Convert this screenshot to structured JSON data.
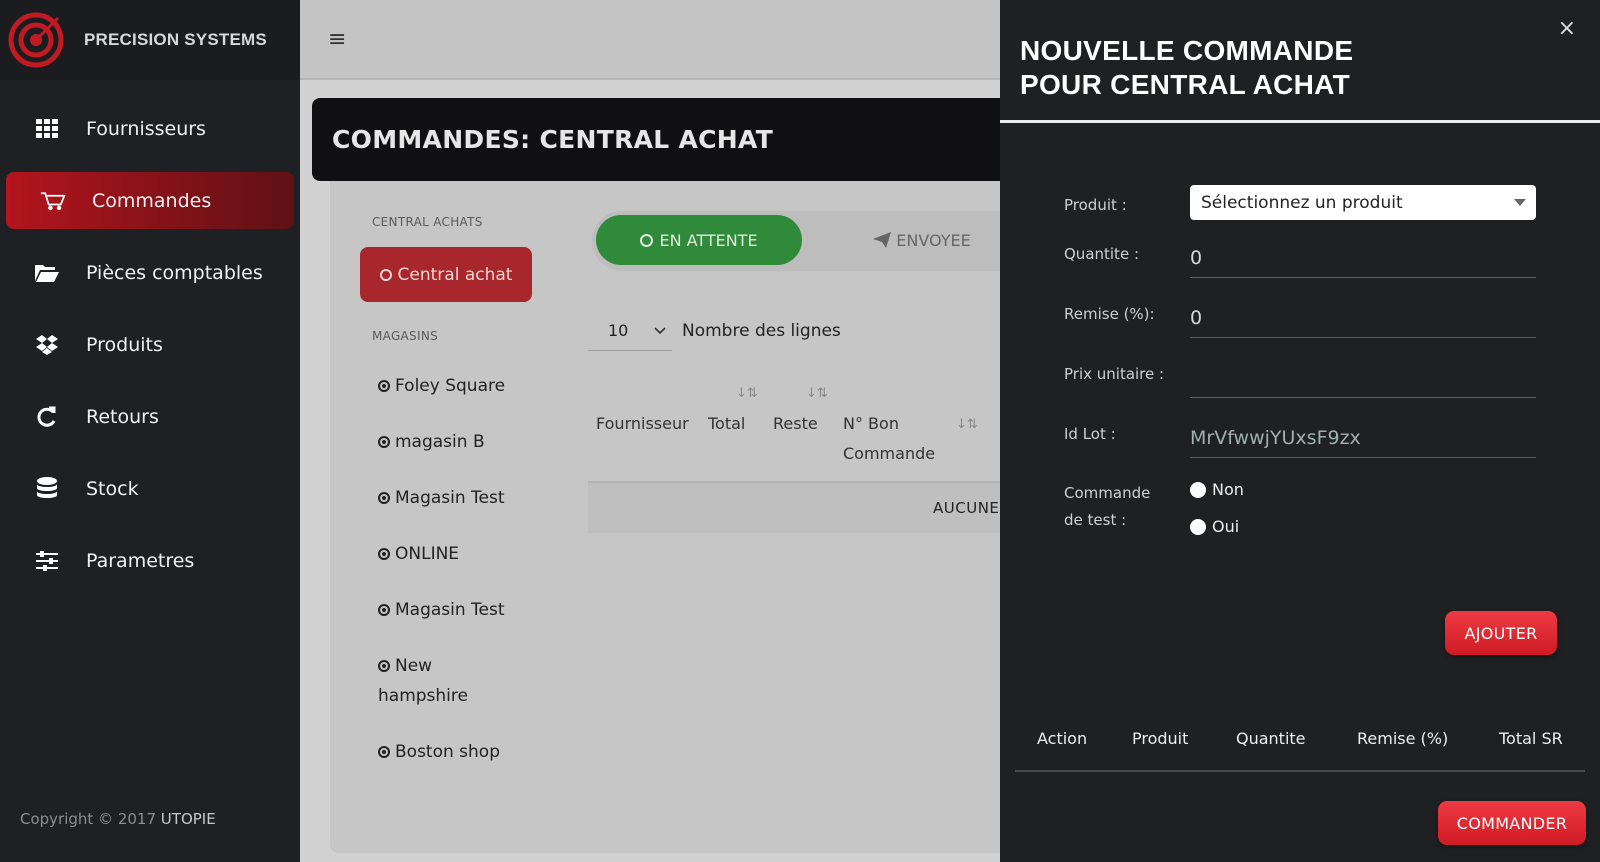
{
  "brand": {
    "name": "PRECISION SYSTEMS"
  },
  "sidebar": {
    "items": [
      {
        "label": "Fournisseurs",
        "icon": "grid-icon"
      },
      {
        "label": "Commandes",
        "icon": "cart-icon",
        "active": true
      },
      {
        "label": "Pièces comptables",
        "icon": "folder-icon"
      },
      {
        "label": "Produits",
        "icon": "dropbox-icon"
      },
      {
        "label": "Retours",
        "icon": "refresh-icon"
      },
      {
        "label": "Stock",
        "icon": "database-icon"
      },
      {
        "label": "Parametres",
        "icon": "sliders-icon"
      }
    ],
    "copyright_prefix": "Copyright © 2017",
    "copyright_brand": "UTOPIE"
  },
  "page": {
    "title": "COMMANDES: CENTRAL ACHAT",
    "central_label": "CENTRAL ACHATS",
    "central_button": "Central achat",
    "stores_label": "MAGASINS",
    "stores": [
      "Foley Square",
      "magasin B",
      "Magasin Test",
      "ONLINE",
      "Magasin Test",
      "New hampshire",
      "Boston shop"
    ],
    "tabs": {
      "pending": "EN ATTENTE",
      "sent": "ENVOYEE"
    },
    "rows_per_page": "10",
    "rows_label": "Nombre des lignes",
    "table": {
      "col_supplier": "Fournisseur",
      "col_total": "Total",
      "col_rest": "Reste",
      "col_order_no_1": "N° Bon",
      "col_order_no_2": "Commande"
    },
    "empty_text": "AUCUNE"
  },
  "drawer": {
    "title_line1": "NOUVELLE COMMANDE",
    "title_line2": "POUR CENTRAL ACHAT",
    "close": "×",
    "product_label": "Produit :",
    "product_placeholder": "Sélectionnez un produit",
    "quantity_label": "Quantite :",
    "quantity_value": "0",
    "discount_label": "Remise (%):",
    "discount_value": "0",
    "unit_price_label": "Prix unitaire :",
    "unit_price_value": "",
    "lot_label": "Id Lot :",
    "lot_value": "MrVfwwjYUxsF9zx",
    "test_label_1": "Commande",
    "test_label_2": "de test :",
    "opt_no": "Non",
    "opt_yes": "Oui",
    "add_button": "AJOUTER",
    "cart_cols": {
      "action": "Action",
      "product": "Produit",
      "quantity": "Quantite",
      "discount": "Remise (%)",
      "total": "Total SR"
    },
    "order_button": "COMMANDER"
  },
  "colors": {
    "accent_red": "#d9232b",
    "pending_green": "#2f8a3a",
    "sidebar_bg": "#1f2024"
  }
}
